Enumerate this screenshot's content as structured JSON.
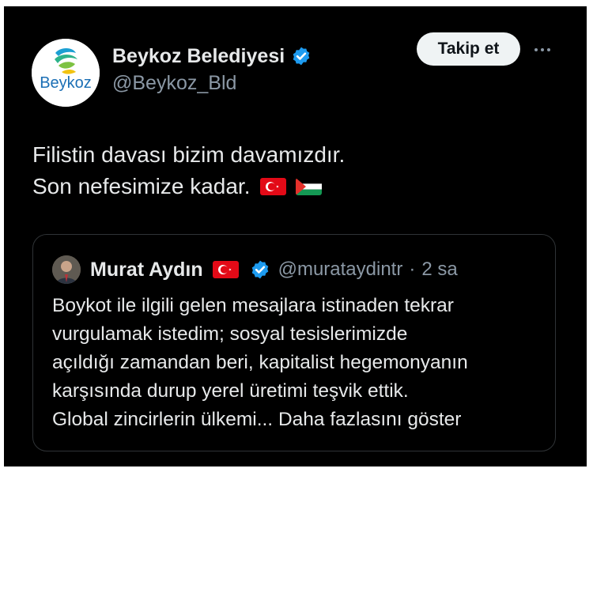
{
  "tweet": {
    "display_name": "Beykoz Belediyesi",
    "handle": "@Beykoz_Bld",
    "avatar_logo_text": "Beykoz",
    "follow_label": "Takip et",
    "more_icon": "more-horizontal-icon",
    "verified_icon": "verified-badge-icon",
    "text_lines": [
      "Filistin davası bizim davamızdır.",
      "Son nefesimize kadar."
    ],
    "flags": [
      "turkey-flag-icon",
      "palestine-flag-icon"
    ]
  },
  "quote": {
    "display_name": "Murat Aydın",
    "handle": "@murataydintr",
    "separator": "·",
    "time": "2 sa",
    "name_flag": "turkey-flag-icon",
    "text_lines": [
      "Boykot ile ilgili gelen mesajlara istinaden tekrar",
      "vurgulamak istedim; sosyal tesislerimizde",
      "açıldığı zamandan beri, kapitalist hegemonyanın",
      "karşısında durup yerel üretimi teşvik ettik.",
      "Global zincirlerin ülkemi..."
    ],
    "show_more_label": "Daha fazlasını göster"
  },
  "colors": {
    "background": "#000000",
    "primary_text": "#e7e9ea",
    "secondary_text": "#8b98a5",
    "verified_blue": "#1d9bf0",
    "follow_button_bg": "#eff3f4",
    "border": "#2f3336"
  }
}
